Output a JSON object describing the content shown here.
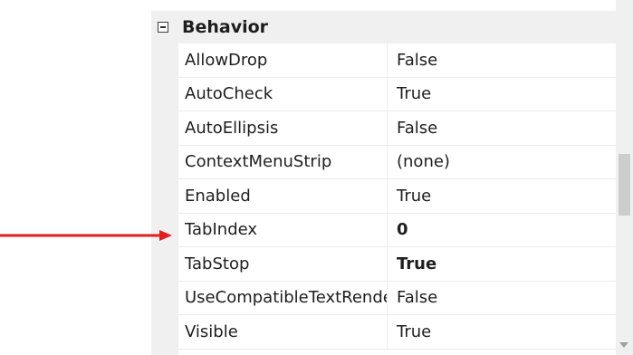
{
  "category": {
    "label": "Behavior",
    "toggle": "collapse-icon"
  },
  "properties": [
    {
      "name": "AllowDrop",
      "value": "False",
      "bold": false
    },
    {
      "name": "AutoCheck",
      "value": "True",
      "bold": false
    },
    {
      "name": "AutoEllipsis",
      "value": "False",
      "bold": false
    },
    {
      "name": "ContextMenuStrip",
      "value": "(none)",
      "bold": false
    },
    {
      "name": "Enabled",
      "value": "True",
      "bold": false
    },
    {
      "name": "TabIndex",
      "value": "0",
      "bold": true
    },
    {
      "name": "TabStop",
      "value": "True",
      "bold": true
    },
    {
      "name": "UseCompatibleTextRendering",
      "value": "False",
      "bold": false
    },
    {
      "name": "Visible",
      "value": "True",
      "bold": false
    }
  ],
  "annotation": {
    "color": "#e02020",
    "points_to": "TabIndex"
  },
  "colors": {
    "gutter": "#f0f0f0",
    "text": "#1e1e1e",
    "grid_line": "#ebebeb"
  }
}
